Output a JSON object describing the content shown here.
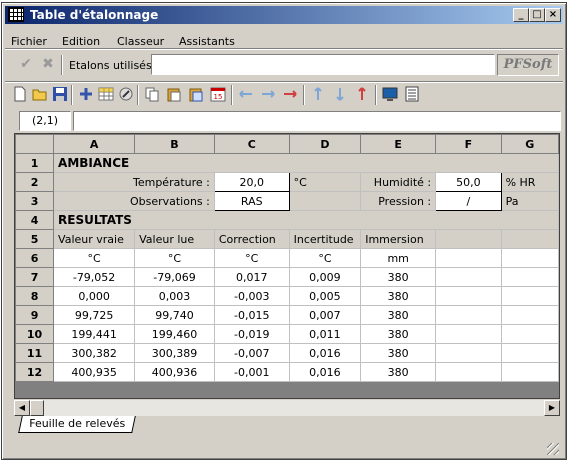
{
  "window": {
    "title": "Table d'étalonnage",
    "controls": [
      "_",
      "□",
      "×"
    ]
  },
  "menu": [
    "Fichier",
    "Edition",
    "Classeur",
    "Assistants"
  ],
  "toolbar1": {
    "etalons_label": "Etalons utilisés :",
    "etalons_value": "",
    "logo": "PFSoft",
    "icons": [
      "check-icon",
      "cancel-icon"
    ]
  },
  "toolbar2": {
    "icons": [
      "new-file-icon",
      "open-folder-icon",
      "save-icon",
      "add-icon",
      "grid-icon",
      "edit-icon",
      "copy-icon",
      "paste-icon",
      "paste-special-icon",
      "calendar-icon",
      "move-left-icon",
      "move-right-icon",
      "move-both-icon",
      "insert-up-icon",
      "insert-down-icon",
      "arrow-up-red-icon",
      "monitor-icon",
      "printer-icon"
    ]
  },
  "cell_ref": "(2,1)",
  "formula": "",
  "columns": [
    "A",
    "B",
    "C",
    "D",
    "E",
    "F",
    "G"
  ],
  "sheet": {
    "ambiance": "AMBIANCE",
    "temperature_label": "Température :",
    "temperature_value": "20,0",
    "temperature_unit": "°C",
    "humidite_label": "Humidité :",
    "humidite_value": "50,0",
    "humidite_unit": "% HR",
    "observations_label": "Observations :",
    "observations_value": "RAS",
    "pression_label": "Pression :",
    "pression_value": "/",
    "pression_unit": "Pa",
    "resultats": "RESULTATS",
    "headers": [
      "Valeur vraie",
      "Valeur lue",
      "Correction",
      "Incertitude",
      "Immersion"
    ],
    "units": [
      "°C",
      "°C",
      "°C",
      "°C",
      "mm"
    ],
    "rows": [
      [
        "-79,052",
        "-79,069",
        "0,017",
        "0,009",
        "380"
      ],
      [
        "0,000",
        "0,003",
        "-0,003",
        "0,005",
        "380"
      ],
      [
        "99,725",
        "99,740",
        "-0,015",
        "0,007",
        "380"
      ],
      [
        "199,441",
        "199,460",
        "-0,019",
        "0,011",
        "380"
      ],
      [
        "300,382",
        "300,389",
        "-0,007",
        "0,016",
        "380"
      ],
      [
        "400,935",
        "400,936",
        "-0,001",
        "0,016",
        "380"
      ]
    ],
    "row_numbers": [
      "1",
      "2",
      "3",
      "4",
      "5",
      "6",
      "7",
      "8",
      "9",
      "10",
      "11",
      "12"
    ]
  },
  "tab": "Feuille de relevés"
}
